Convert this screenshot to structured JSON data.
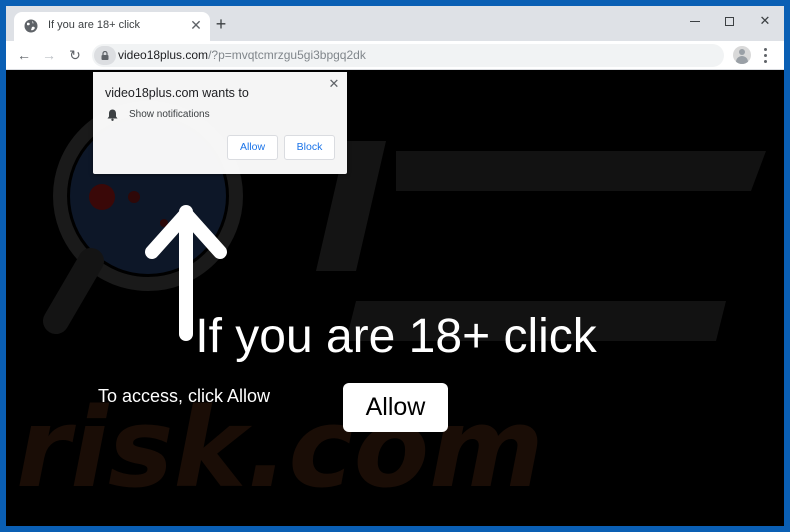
{
  "browser": {
    "tab": {
      "title": "If you are 18+ click",
      "favicon": "globe-icon",
      "close_icon": "close-icon"
    },
    "new_tab_icon": "plus-icon",
    "window_controls": {
      "minimize": "minimize-icon",
      "maximize": "maximize-icon",
      "close": "close-icon"
    },
    "toolbar": {
      "back_icon": "arrow-left-icon",
      "forward_icon": "arrow-right-icon",
      "reload_icon": "reload-icon",
      "lock_icon": "lock-icon",
      "url_host": "video18plus.com",
      "url_rest": "/?p=mvqtcmrzgu5gi3bpgq2dk",
      "bookmark_icon": "star-icon",
      "profile_icon": "avatar-icon",
      "menu_icon": "kebab-menu-icon"
    }
  },
  "permission_popup": {
    "title": "video18plus.com wants to",
    "permission": "Show notifications",
    "permission_icon": "bell-icon",
    "allow_label": "Allow",
    "block_label": "Block",
    "close_icon": "close-icon"
  },
  "page": {
    "headline": "If you are 18+ click",
    "subtext": "To access, click Allow",
    "allow_button": "Allow",
    "arrow_icon": "arrow-up-icon",
    "watermark_text": "PC risk.com"
  },
  "colors": {
    "window_frame": "#0a5fb4",
    "page_background": "#000000",
    "popup_button_text": "#1a73e8"
  }
}
